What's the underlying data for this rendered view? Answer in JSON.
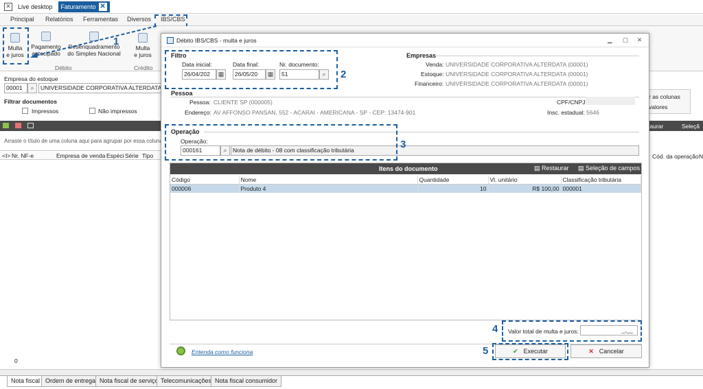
{
  "window": {
    "tab_live": "Live desktop",
    "tab_active": "Faturamento"
  },
  "ribbon": {
    "tabs": [
      "Principal",
      "Relatórios",
      "Ferramentas",
      "Diversos",
      "IBS/CBS"
    ],
    "buttons": {
      "multa": "Multa\ne juros",
      "pagamento": "Pagamento\nantecipado",
      "desenq": "Desenquadramento\ndo Simples Nacional",
      "multa2": "Multa\ne juros"
    },
    "groups": {
      "debito": "Débito",
      "credito": "Crédito"
    }
  },
  "left": {
    "empresa_label": "Empresa do estoque",
    "empresa_code": "00001",
    "empresa_name": "UNIVERSIDADE CORPORATIVA ALTERDATA",
    "filtrar_label": "Filtrar documentos",
    "impressos": "Impressos",
    "nao_impressos": "Não impressos",
    "group_hint": "Arraste o título de uma coluna aqui para agrupar por essa coluna",
    "columns": [
      "<I>",
      "Nr. NF-e",
      "Empresa de venda",
      "Espéci",
      "Série",
      "Tipo"
    ],
    "footer_count": "0"
  },
  "right": {
    "as_colunas": "r as colunas",
    "valores": "valores",
    "restaurar": "taurar",
    "selecao": "Seleçã",
    "cod_op": "Cód. da operação",
    "n": "N"
  },
  "dialog": {
    "title": "Débito IBS/CBS - multa e juros",
    "filtro": {
      "title": "Filtro",
      "data_inicial_label": "Data inicial:",
      "data_inicial": "26/04/202",
      "data_final_label": "Data final:",
      "data_final": "26/05/20",
      "nr_doc_label": "Nr. documento:",
      "nr_doc": "51"
    },
    "empresas": {
      "title": "Empresas",
      "venda_label": "Venda:",
      "venda": "UNIVERSIDADE CORPORATIVA ALTERDATA (00001)",
      "estoque_label": "Estoque:",
      "estoque": "UNIVERSIDADE CORPORATIVA ALTERDATA (00001)",
      "financeiro_label": "Financeiro:",
      "financeiro": "UNIVERSIDADE CORPORATIVA ALTERDATA (00001)"
    },
    "pessoa": {
      "title": "Pessoa",
      "pessoa_label": "Pessoa:",
      "pessoa": "CLIENTE SP (000005)",
      "endereco_label": "Endereço:",
      "endereco": "AV   AFFONSO PANSAN, 552 - ACARAI - AMERICANA - SP - CEP: 13474-901",
      "cpf_label": "CPF/CNPJ:",
      "insc_label": "Insc. estadual:",
      "insc": "5646"
    },
    "operacao": {
      "title": "Operação",
      "label": "Operação:",
      "code": "000161",
      "desc": "Nota de débito - 08 com classificação tributária"
    },
    "itens": {
      "title": "Itens do documento",
      "restaurar": "Restaurar",
      "selecao": "Seleção de campos",
      "columns": [
        "Código",
        "Nome",
        "Quantidade",
        "Vl. unitário",
        "Classificação tributária"
      ],
      "rows": [
        [
          "000006",
          "Produto 4",
          "10",
          "R$ 100,00",
          "000001"
        ]
      ]
    },
    "valor_label": "Valor total de multa e juros:",
    "valor": "_,__",
    "link": "Entenda como funciona",
    "executar": "Executar",
    "cancelar": "Cancelar"
  },
  "callouts": [
    "1",
    "2",
    "3",
    "4",
    "5"
  ],
  "bottom_tabs": [
    "Nota fiscal",
    "Ordem de entrega",
    "Nota fiscal de serviço",
    "Telecomunicações",
    "Nota fiscal consumidor"
  ],
  "colors": {
    "accent": "#1b5e9f",
    "header_dark": "#4a4a4a",
    "selected_row": "#c5d9ea"
  }
}
